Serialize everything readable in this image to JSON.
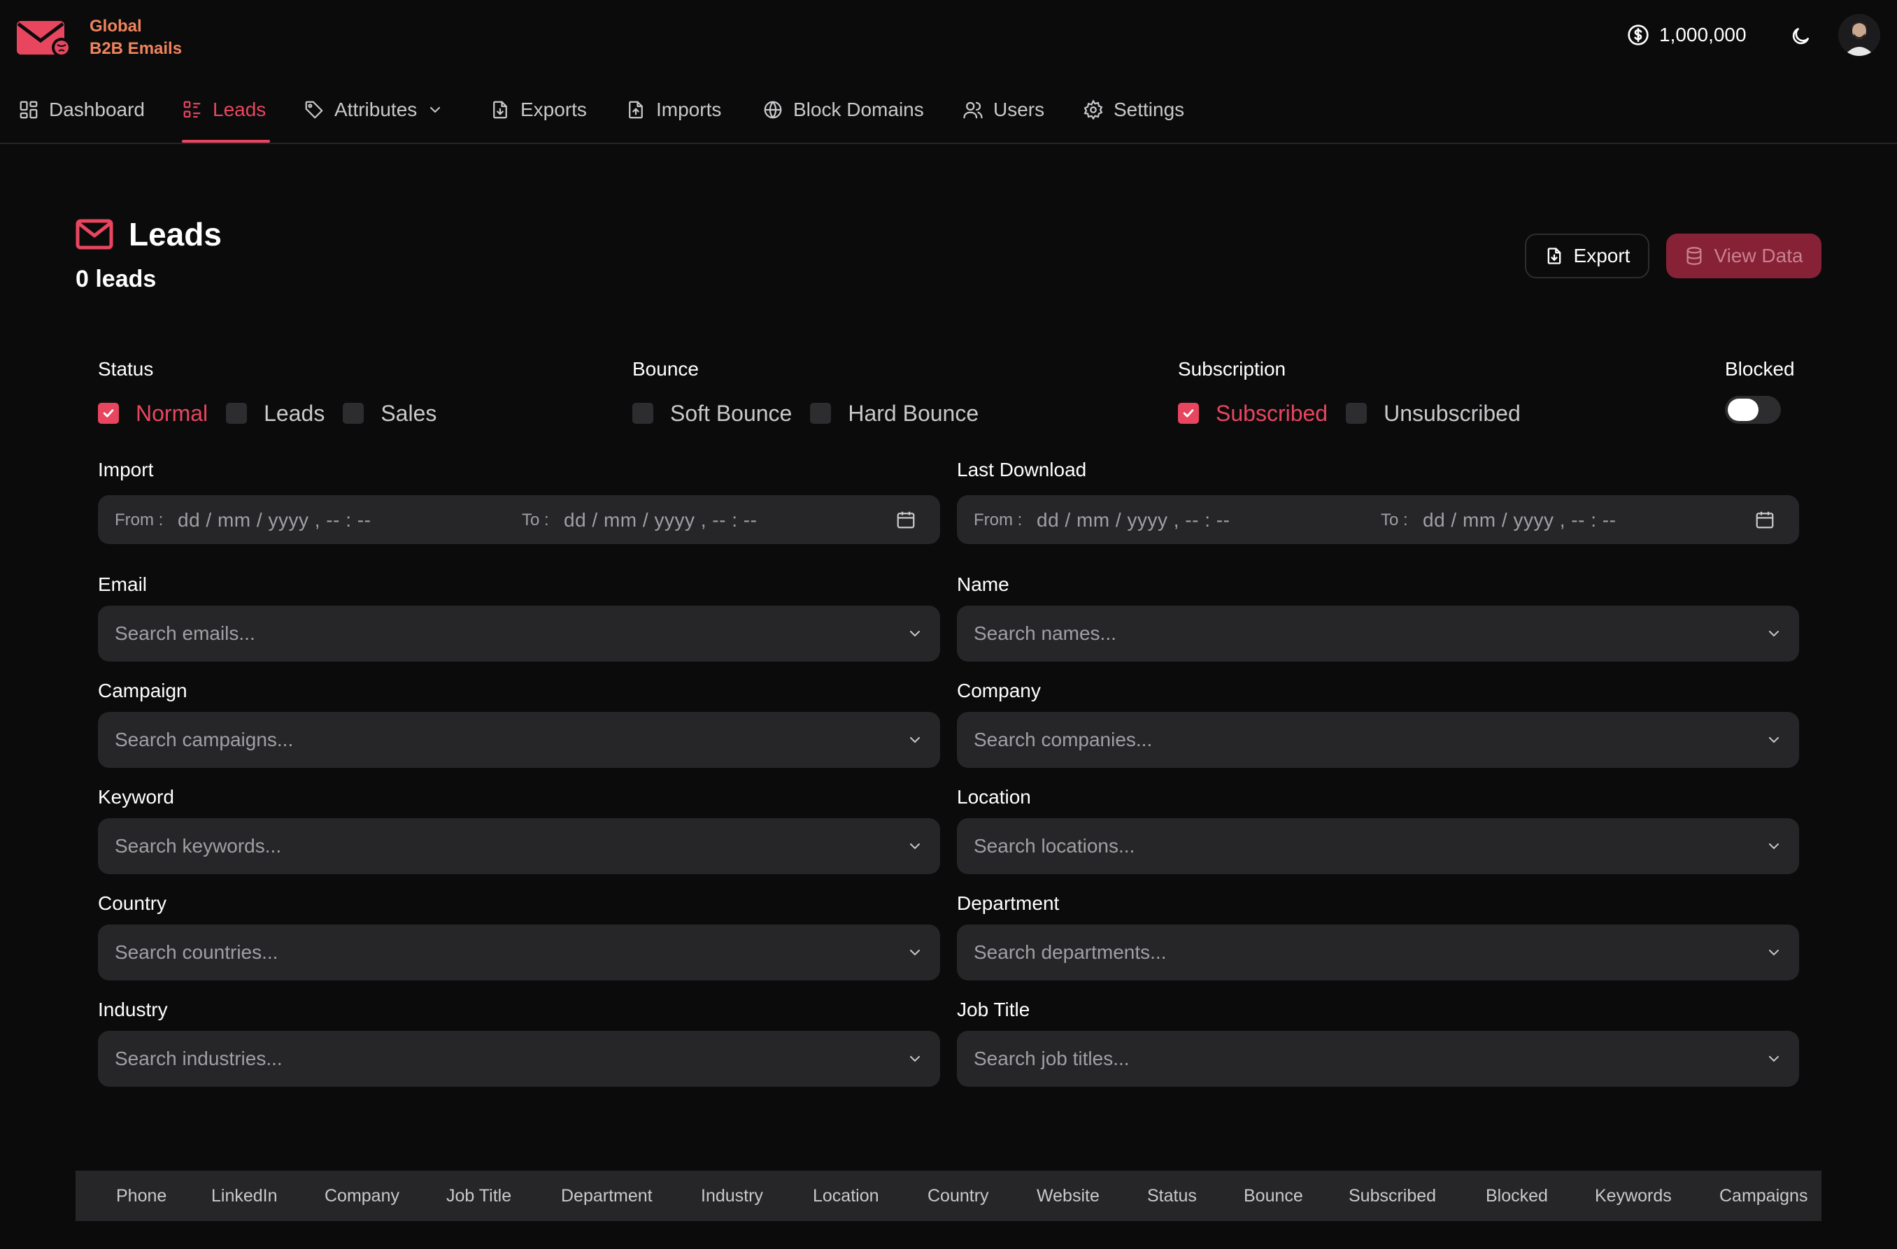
{
  "app": {
    "brand_line1": "Global",
    "brand_line2": "B2B Emails",
    "brand_color": "#f0845c",
    "accent_color": "#e8465f",
    "credits": "1,000,000"
  },
  "nav": {
    "items": [
      {
        "label": "Dashboard",
        "icon": "dashboard-icon"
      },
      {
        "label": "Leads",
        "icon": "leads-icon",
        "active": true
      },
      {
        "label": "Attributes",
        "icon": "tag-icon"
      },
      {
        "label": "Exports",
        "icon": "file-export-icon"
      },
      {
        "label": "Imports",
        "icon": "file-import-icon"
      },
      {
        "label": "Block Domains",
        "icon": "globe-icon"
      },
      {
        "label": "Users",
        "icon": "users-icon"
      },
      {
        "label": "Settings",
        "icon": "gear-icon"
      }
    ]
  },
  "page": {
    "title": "Leads",
    "count": "0 leads",
    "export_label": "Export",
    "view_data_label": "View Data"
  },
  "filters": {
    "status": {
      "label": "Status",
      "options": [
        {
          "label": "Normal",
          "checked": true
        },
        {
          "label": "Leads",
          "checked": false
        },
        {
          "label": "Sales",
          "checked": false
        }
      ]
    },
    "bounce": {
      "label": "Bounce",
      "options": [
        {
          "label": "Soft Bounce",
          "checked": false
        },
        {
          "label": "Hard Bounce",
          "checked": false
        }
      ]
    },
    "subscription": {
      "label": "Subscription",
      "options": [
        {
          "label": "Subscribed",
          "checked": true
        },
        {
          "label": "Unsubscribed",
          "checked": false
        }
      ]
    },
    "blocked": {
      "label": "Blocked",
      "on": false
    },
    "import": {
      "label": "Import",
      "from_label": "From :",
      "to_label": "To :",
      "placeholder": "dd / mm / yyyy ,  -- : --"
    },
    "last_download": {
      "label": "Last Download",
      "from_label": "From :",
      "to_label": "To :",
      "placeholder": "dd / mm / yyyy ,  -- : --"
    },
    "email": {
      "label": "Email",
      "placeholder": "Search emails..."
    },
    "name": {
      "label": "Name",
      "placeholder": "Search names..."
    },
    "campaign": {
      "label": "Campaign",
      "placeholder": "Search campaigns..."
    },
    "company": {
      "label": "Company",
      "placeholder": "Search companies..."
    },
    "keyword": {
      "label": "Keyword",
      "placeholder": "Search keywords..."
    },
    "location": {
      "label": "Location",
      "placeholder": "Search locations..."
    },
    "country": {
      "label": "Country",
      "placeholder": "Search countries..."
    },
    "department": {
      "label": "Department",
      "placeholder": "Search departments..."
    },
    "industry": {
      "label": "Industry",
      "placeholder": "Search industries..."
    },
    "job_title": {
      "label": "Job Title",
      "placeholder": "Search job titles..."
    }
  },
  "table": {
    "columns": [
      "Phone",
      "LinkedIn",
      "Company",
      "Job Title",
      "Department",
      "Industry",
      "Location",
      "Country",
      "Website",
      "Status",
      "Bounce",
      "Subscribed",
      "Blocked",
      "Keywords",
      "Campaigns"
    ]
  }
}
